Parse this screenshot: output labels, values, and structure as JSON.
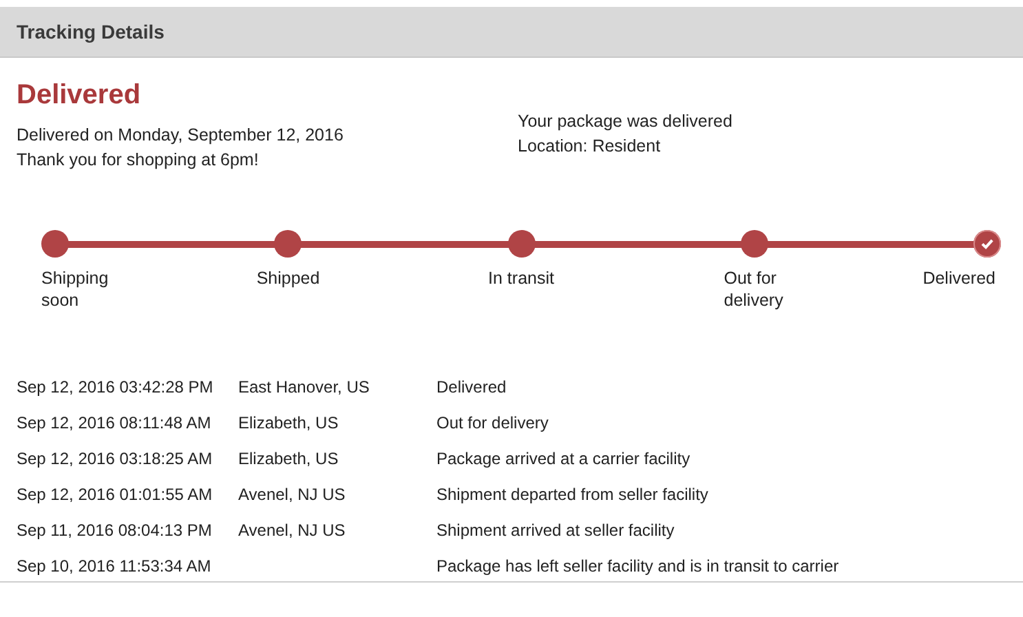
{
  "header": {
    "title": "Tracking Details"
  },
  "status": {
    "title": "Delivered",
    "lines": [
      "Delivered on Monday, September 12, 2016",
      "Thank you for shopping at 6pm!"
    ],
    "details": [
      "Your package was delivered",
      "Location: Resident"
    ]
  },
  "steps": [
    {
      "label": "Shipping soon",
      "done": true,
      "current": false
    },
    {
      "label": "Shipped",
      "done": true,
      "current": false
    },
    {
      "label": "In transit",
      "done": true,
      "current": false
    },
    {
      "label": "Out for delivery",
      "done": true,
      "current": false
    },
    {
      "label": "Delivered",
      "done": true,
      "current": true
    }
  ],
  "events": [
    {
      "time": "Sep 12, 2016 03:42:28 PM",
      "location": "East Hanover, US",
      "description": "Delivered"
    },
    {
      "time": "Sep 12, 2016 08:11:48 AM",
      "location": "Elizabeth, US",
      "description": "Out for delivery"
    },
    {
      "time": "Sep 12, 2016 03:18:25 AM",
      "location": "Elizabeth, US",
      "description": "Package arrived at a carrier facility"
    },
    {
      "time": "Sep 12, 2016 01:01:55 AM",
      "location": "Avenel, NJ US",
      "description": "Shipment departed from seller facility"
    },
    {
      "time": "Sep 11, 2016 08:04:13 PM",
      "location": "Avenel, NJ US",
      "description": "Shipment arrived at seller facility"
    },
    {
      "time": "Sep 10, 2016 11:53:34 AM",
      "description": "Package has left seller facility and is in transit to carrier"
    }
  ]
}
